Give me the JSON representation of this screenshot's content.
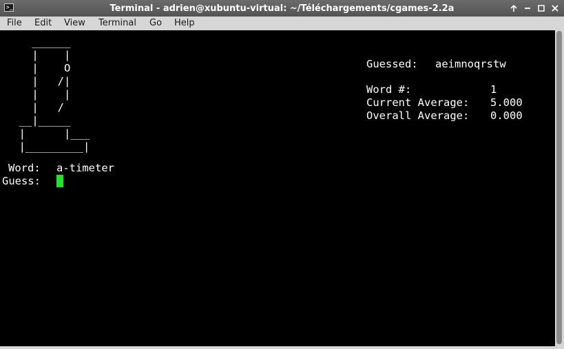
{
  "window": {
    "title": "Terminal - adrien@xubuntu-virtual: ~/Téléchargements/cgames-2.2a",
    "app_icon_glyph": ">_"
  },
  "menubar": {
    "items": [
      "File",
      "Edit",
      "View",
      "Terminal",
      "Go",
      "Help"
    ]
  },
  "terminal": {
    "gallows": [
      "    ______",
      "    |    |",
      "    |    O",
      "    |   /|",
      "    |    |",
      "    |   /",
      "  __|_____",
      "  |      |___",
      "  |_________|"
    ],
    "guessed_label": "Guessed:",
    "guessed_letters": "aeimnoqrstw",
    "word_number_label": "Word #:",
    "word_number_value": "1",
    "current_average_label": "Current Average:",
    "current_average_value": "5.000",
    "overall_average_label": "Overall Average:",
    "overall_average_value": "0.000",
    "word_label": "Word:",
    "word_value": "a-timeter",
    "guess_label": "Guess:",
    "cursor_color": "#1ee61e"
  }
}
